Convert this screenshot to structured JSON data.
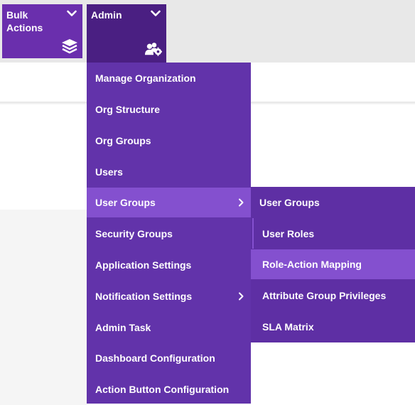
{
  "toolbar": {
    "bulk_actions": {
      "label": "Bulk Actions",
      "icon": "layers-icon"
    },
    "admin": {
      "label": "Admin",
      "icon": "users-gear-icon"
    }
  },
  "admin_menu": {
    "items": [
      {
        "label": "Manage Organization"
      },
      {
        "label": "Org Structure"
      },
      {
        "label": "Org Groups"
      },
      {
        "label": "Users"
      },
      {
        "label": "User Groups",
        "has_submenu": true,
        "active": true
      },
      {
        "label": "Security Groups"
      },
      {
        "label": "Application Settings"
      },
      {
        "label": "Notification Settings",
        "has_submenu": true
      },
      {
        "label": "Admin Task"
      },
      {
        "label": "Dashboard Configuration"
      },
      {
        "label": "Action Button Configuration"
      }
    ]
  },
  "user_groups_submenu": {
    "header": "User Groups",
    "items": [
      {
        "label": "User Roles"
      },
      {
        "label": "Role-Action Mapping",
        "active": true
      },
      {
        "label": "Attribute Group Privileges"
      },
      {
        "label": "SLA Matrix"
      }
    ]
  },
  "colors": {
    "tile": "#6a2fad",
    "tile_active": "#4a1f82",
    "menu_bg": "#6233aa",
    "highlight": "#8450cf",
    "topbar_bg": "#e8e8e8"
  }
}
